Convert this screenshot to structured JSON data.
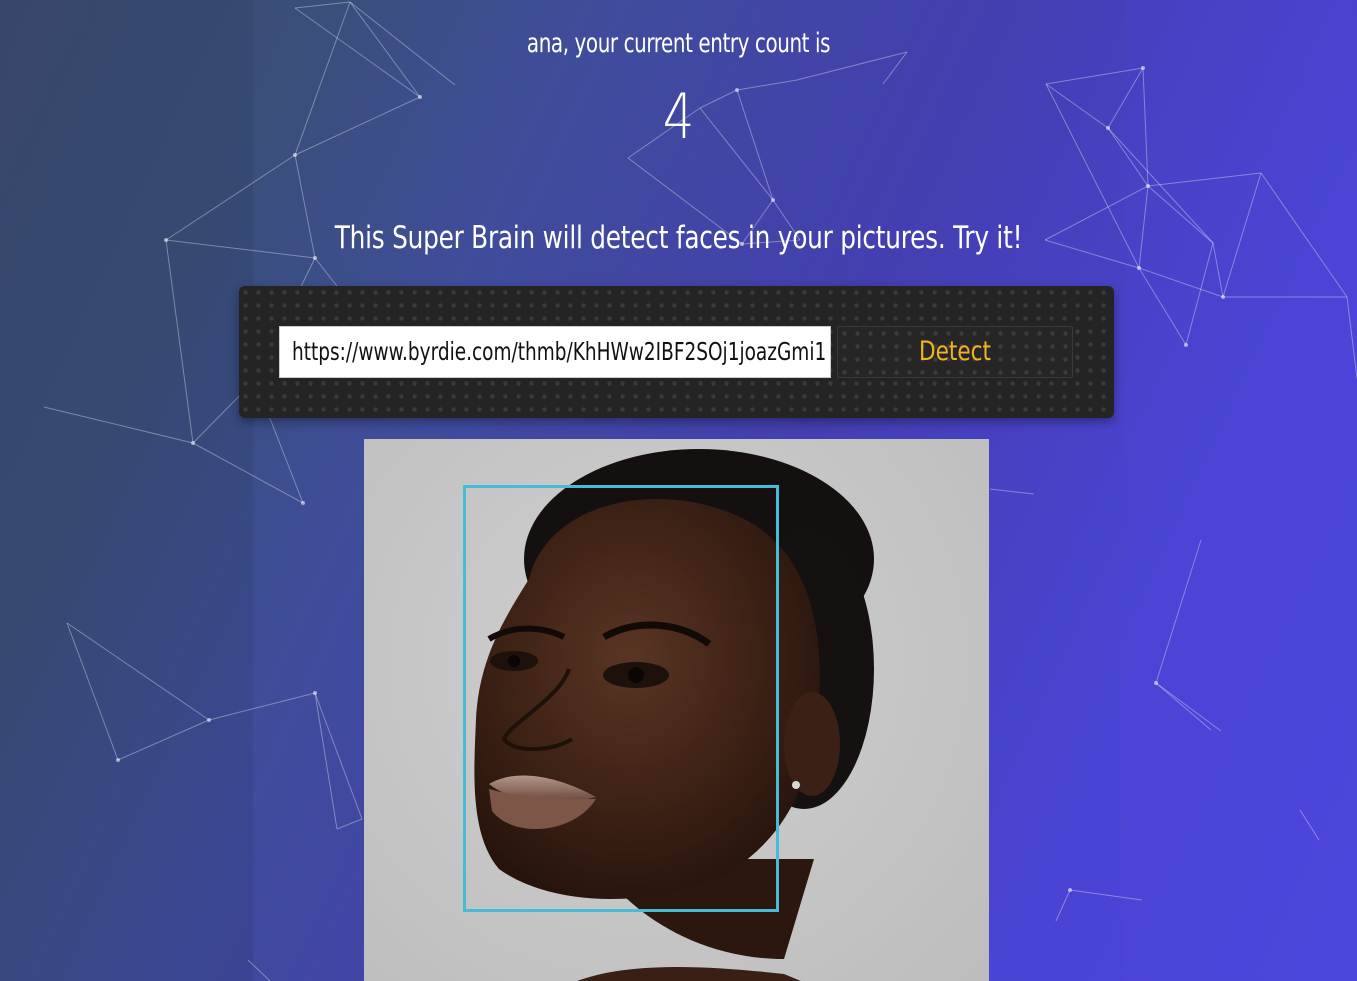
{
  "greeting": {
    "user": "ana",
    "text": "ana, your current entry count is"
  },
  "entry_count": "4",
  "tagline": "This Super Brain will detect faces in your pictures. Try it!",
  "image_form": {
    "url_value": "https://www.byrdie.com/thmb/KhHWw2IBF2SOj1joazGmi1",
    "detect_label": "Detect"
  },
  "result": {
    "faces_detected": 1
  },
  "colors": {
    "accent": "#f2b41e",
    "face_box": "#48bcd6",
    "panel": "#242424"
  },
  "icons": {
    "background": "particle-network"
  }
}
